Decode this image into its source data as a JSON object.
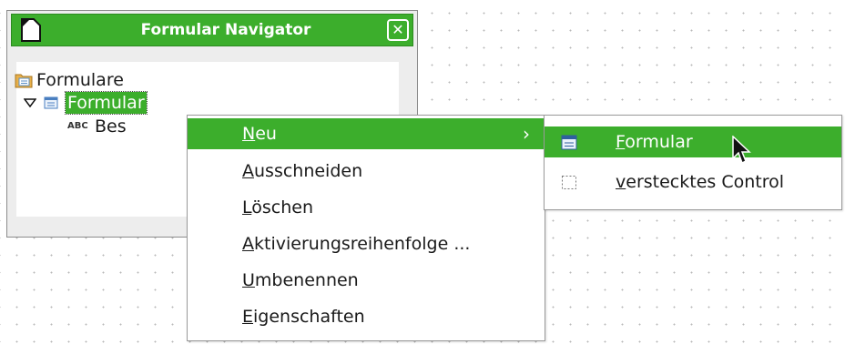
{
  "navigator": {
    "title": "Formular Navigator",
    "close_glyph": "✕",
    "tree": {
      "root_label": "Formulare",
      "form_label": "Formular",
      "control_type": "ABC",
      "control_label": "Bes"
    }
  },
  "context_menu": {
    "items": [
      {
        "label": "Neu",
        "mnemonic": "N",
        "rest": "eu",
        "highlighted": true,
        "has_submenu": true
      },
      {
        "label": "Ausschneiden",
        "mnemonic": "A",
        "rest": "usschneiden"
      },
      {
        "label": "Löschen",
        "mnemonic": "L",
        "rest": "öschen"
      },
      {
        "label": "Aktivierungsreihenfolge ...",
        "mnemonic": "A",
        "rest": "ktivierungsreihenfolge ..."
      },
      {
        "label": "Umbenennen",
        "mnemonic": "U",
        "rest": "mbenennen"
      },
      {
        "label": "Eigenschaften",
        "mnemonic": "E",
        "rest": "igenschaften"
      }
    ],
    "submenu_arrow": "›"
  },
  "submenu": {
    "items": [
      {
        "label": "Formular",
        "mnemonic": "F",
        "rest": "ormular",
        "highlighted": true,
        "icon": "form-icon"
      },
      {
        "label": "verstecktes Control",
        "mnemonic": "v",
        "rest": "erstecktes Control",
        "icon": "hidden-control-icon"
      }
    ]
  },
  "colors": {
    "accent": "#3cae2c",
    "panel": "#ededed"
  }
}
